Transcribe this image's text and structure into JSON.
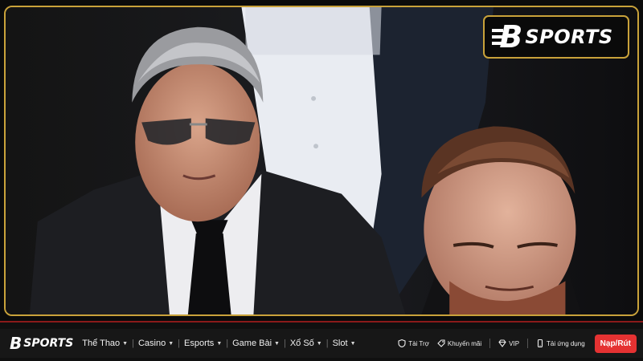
{
  "brand": {
    "name": "SPORTS",
    "mark": "B"
  },
  "nav": {
    "menu": [
      {
        "label": "Thể Thao",
        "caret": "▼"
      },
      {
        "label": "Casino",
        "caret": "▼"
      },
      {
        "label": "Esports",
        "caret": "▼"
      },
      {
        "label": "Game Bài",
        "caret": "▼"
      },
      {
        "label": "Xổ Số",
        "caret": "▼"
      },
      {
        "label": "Slot",
        "caret": "▼"
      }
    ],
    "separator": "|",
    "links": [
      {
        "label": "Tài Trợ",
        "icon": "shield-icon"
      },
      {
        "label": "Khuyến mãi",
        "icon": "tag-icon"
      },
      {
        "label": "VIP",
        "icon": "diamond-icon"
      },
      {
        "label": "Tải ứng dụng",
        "icon": "phone-icon"
      }
    ],
    "cta": "Nạp/Rút"
  },
  "colors": {
    "gold_border": "#c9a23a",
    "red_accent": "#e53232",
    "bar_bg": "#171717"
  }
}
